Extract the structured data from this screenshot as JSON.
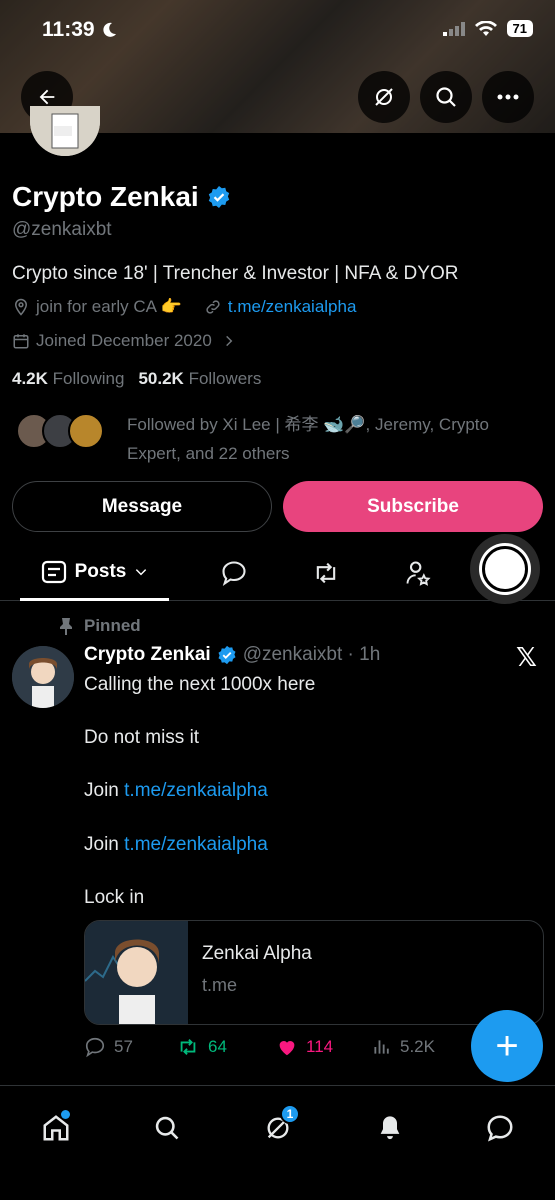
{
  "status_bar": {
    "time": "11:39",
    "battery": "71"
  },
  "profile": {
    "name": "Crypto Zenkai",
    "handle": "@zenkaixbt",
    "bio": "Crypto since 18' | Trencher & Investor | NFA & DYOR",
    "location": "join for early CA 👉",
    "link": "t.me/zenkaialpha",
    "joined": "Joined December 2020",
    "following_count": "4.2K",
    "following_label": "Following",
    "followers_count": "50.2K",
    "followers_label": "Followers",
    "followed_by": "Followed by Xi Lee | 希李 🐋🔎, Jeremy, Crypto Expert, and 22 others"
  },
  "buttons": {
    "message": "Message",
    "subscribe": "Subscribe"
  },
  "tabs": {
    "posts": "Posts"
  },
  "post": {
    "pinned_label": "Pinned",
    "author": "Crypto Zenkai",
    "handle_time": "@zenkaixbt · 1h",
    "x_logo": "𝕏",
    "lines": {
      "l1": "Calling the next 1000x here",
      "l2": "Do not miss it",
      "l3_prefix": "Join",
      "l3_link": "t.me/zenkaialpha",
      "l4_prefix": "Join",
      "l4_link": "t.me/zenkaialpha",
      "l5": "Lock in"
    },
    "card": {
      "title": "Zenkai Alpha",
      "domain": "t.me"
    },
    "stats": {
      "replies": "57",
      "reposts": "64",
      "likes": "114",
      "views": "5.2K"
    }
  },
  "fab": {
    "label": "+"
  },
  "nav": {
    "messages_badge": "1"
  },
  "colors": {
    "accent": "#1d9bf0",
    "subscribe": "#e8447e",
    "repost": "#00ba7c",
    "like": "#f91880"
  }
}
